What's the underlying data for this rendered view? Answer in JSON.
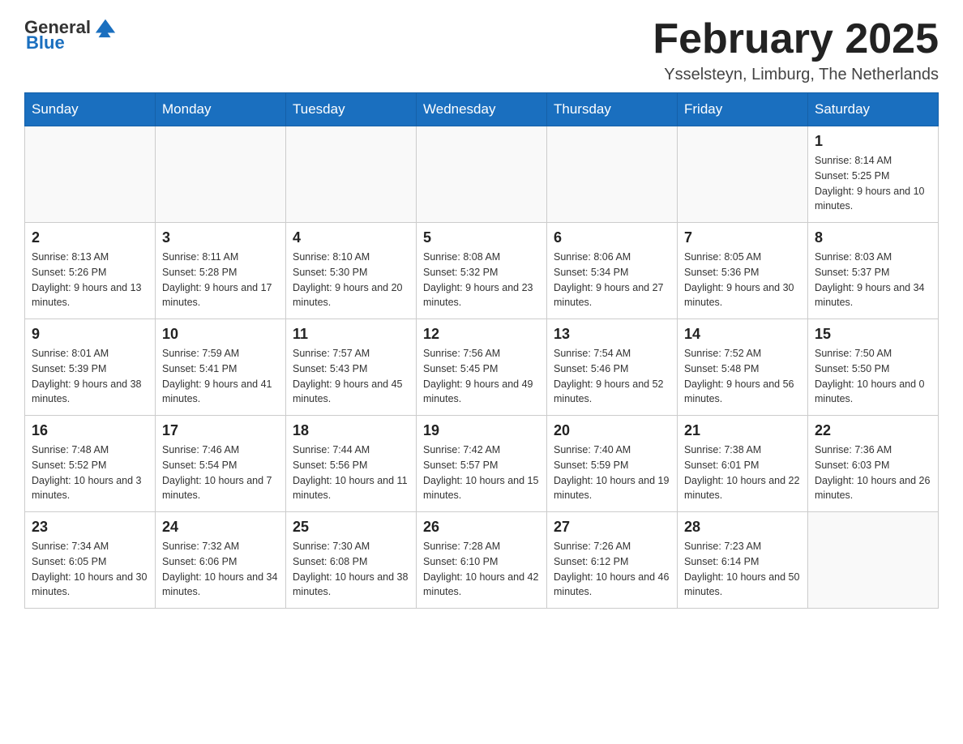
{
  "header": {
    "logo_general": "General",
    "logo_blue": "Blue",
    "month_title": "February 2025",
    "subtitle": "Ysselsteyn, Limburg, The Netherlands"
  },
  "days_of_week": [
    "Sunday",
    "Monday",
    "Tuesday",
    "Wednesday",
    "Thursday",
    "Friday",
    "Saturday"
  ],
  "weeks": [
    [
      {
        "day": "",
        "info": ""
      },
      {
        "day": "",
        "info": ""
      },
      {
        "day": "",
        "info": ""
      },
      {
        "day": "",
        "info": ""
      },
      {
        "day": "",
        "info": ""
      },
      {
        "day": "",
        "info": ""
      },
      {
        "day": "1",
        "info": "Sunrise: 8:14 AM\nSunset: 5:25 PM\nDaylight: 9 hours and 10 minutes."
      }
    ],
    [
      {
        "day": "2",
        "info": "Sunrise: 8:13 AM\nSunset: 5:26 PM\nDaylight: 9 hours and 13 minutes."
      },
      {
        "day": "3",
        "info": "Sunrise: 8:11 AM\nSunset: 5:28 PM\nDaylight: 9 hours and 17 minutes."
      },
      {
        "day": "4",
        "info": "Sunrise: 8:10 AM\nSunset: 5:30 PM\nDaylight: 9 hours and 20 minutes."
      },
      {
        "day": "5",
        "info": "Sunrise: 8:08 AM\nSunset: 5:32 PM\nDaylight: 9 hours and 23 minutes."
      },
      {
        "day": "6",
        "info": "Sunrise: 8:06 AM\nSunset: 5:34 PM\nDaylight: 9 hours and 27 minutes."
      },
      {
        "day": "7",
        "info": "Sunrise: 8:05 AM\nSunset: 5:36 PM\nDaylight: 9 hours and 30 minutes."
      },
      {
        "day": "8",
        "info": "Sunrise: 8:03 AM\nSunset: 5:37 PM\nDaylight: 9 hours and 34 minutes."
      }
    ],
    [
      {
        "day": "9",
        "info": "Sunrise: 8:01 AM\nSunset: 5:39 PM\nDaylight: 9 hours and 38 minutes."
      },
      {
        "day": "10",
        "info": "Sunrise: 7:59 AM\nSunset: 5:41 PM\nDaylight: 9 hours and 41 minutes."
      },
      {
        "day": "11",
        "info": "Sunrise: 7:57 AM\nSunset: 5:43 PM\nDaylight: 9 hours and 45 minutes."
      },
      {
        "day": "12",
        "info": "Sunrise: 7:56 AM\nSunset: 5:45 PM\nDaylight: 9 hours and 49 minutes."
      },
      {
        "day": "13",
        "info": "Sunrise: 7:54 AM\nSunset: 5:46 PM\nDaylight: 9 hours and 52 minutes."
      },
      {
        "day": "14",
        "info": "Sunrise: 7:52 AM\nSunset: 5:48 PM\nDaylight: 9 hours and 56 minutes."
      },
      {
        "day": "15",
        "info": "Sunrise: 7:50 AM\nSunset: 5:50 PM\nDaylight: 10 hours and 0 minutes."
      }
    ],
    [
      {
        "day": "16",
        "info": "Sunrise: 7:48 AM\nSunset: 5:52 PM\nDaylight: 10 hours and 3 minutes."
      },
      {
        "day": "17",
        "info": "Sunrise: 7:46 AM\nSunset: 5:54 PM\nDaylight: 10 hours and 7 minutes."
      },
      {
        "day": "18",
        "info": "Sunrise: 7:44 AM\nSunset: 5:56 PM\nDaylight: 10 hours and 11 minutes."
      },
      {
        "day": "19",
        "info": "Sunrise: 7:42 AM\nSunset: 5:57 PM\nDaylight: 10 hours and 15 minutes."
      },
      {
        "day": "20",
        "info": "Sunrise: 7:40 AM\nSunset: 5:59 PM\nDaylight: 10 hours and 19 minutes."
      },
      {
        "day": "21",
        "info": "Sunrise: 7:38 AM\nSunset: 6:01 PM\nDaylight: 10 hours and 22 minutes."
      },
      {
        "day": "22",
        "info": "Sunrise: 7:36 AM\nSunset: 6:03 PM\nDaylight: 10 hours and 26 minutes."
      }
    ],
    [
      {
        "day": "23",
        "info": "Sunrise: 7:34 AM\nSunset: 6:05 PM\nDaylight: 10 hours and 30 minutes."
      },
      {
        "day": "24",
        "info": "Sunrise: 7:32 AM\nSunset: 6:06 PM\nDaylight: 10 hours and 34 minutes."
      },
      {
        "day": "25",
        "info": "Sunrise: 7:30 AM\nSunset: 6:08 PM\nDaylight: 10 hours and 38 minutes."
      },
      {
        "day": "26",
        "info": "Sunrise: 7:28 AM\nSunset: 6:10 PM\nDaylight: 10 hours and 42 minutes."
      },
      {
        "day": "27",
        "info": "Sunrise: 7:26 AM\nSunset: 6:12 PM\nDaylight: 10 hours and 46 minutes."
      },
      {
        "day": "28",
        "info": "Sunrise: 7:23 AM\nSunset: 6:14 PM\nDaylight: 10 hours and 50 minutes."
      },
      {
        "day": "",
        "info": ""
      }
    ]
  ]
}
